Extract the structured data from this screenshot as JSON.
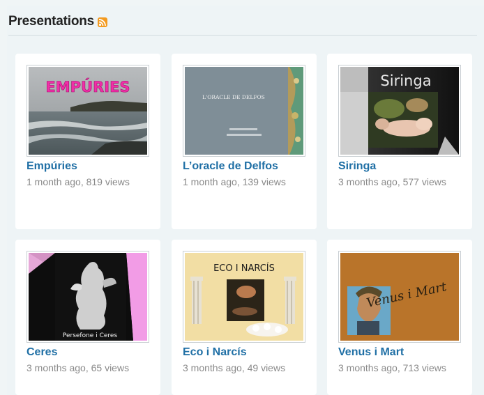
{
  "section": {
    "title": "Presentations",
    "feed_icon": "rss-icon"
  },
  "presentations": [
    {
      "title": "Empúries",
      "meta": "1 month ago, 819 views",
      "thumb_text": "EMPÚRIES"
    },
    {
      "title": "L’oracle de Delfos",
      "meta": "1 month ago, 139 views",
      "thumb_text": "L'ORACLE DE DELFOS"
    },
    {
      "title": "Siringa",
      "meta": "3 months ago, 577 views",
      "thumb_text": "Siringa"
    },
    {
      "title": "Ceres",
      "meta": "3 months ago, 65 views",
      "thumb_text": "Persefone i Ceres"
    },
    {
      "title": "Eco i Narcís",
      "meta": "3 months ago, 49 views",
      "thumb_text": "ECO I NARCÍS"
    },
    {
      "title": "Venus i Mart",
      "meta": "3 months ago, 713 views",
      "thumb_text": "Venus i Mart"
    }
  ],
  "colors": {
    "link": "#1f6fa5",
    "meta": "#8a8a8a",
    "rss": "#f39a1f"
  }
}
